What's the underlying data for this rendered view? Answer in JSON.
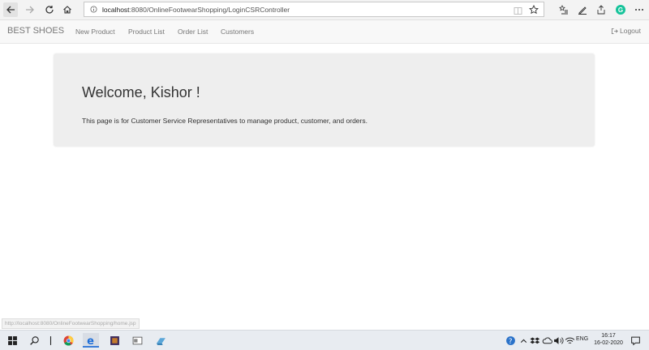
{
  "browser": {
    "url_host": "localhost",
    "url_path": ":8080/OnlineFootwearShopping/LoginCSRController"
  },
  "navbar": {
    "brand": "BEST SHOES",
    "links": [
      "New Product",
      "Product List",
      "Order List",
      "Customers"
    ],
    "logout_label": "Logout"
  },
  "jumbotron": {
    "heading": "Welcome, Kishor !",
    "text": "This page is for Customer Service Representatives to manage product, customer, and orders."
  },
  "status_bar_url": "http://localhost:8080/OnlineFootwearShopping/home.jsp",
  "taskbar": {
    "language": "ENG",
    "time": "16:17",
    "date": "16-02-2020"
  },
  "colors": {
    "navbar_bg": "#f8f8f8",
    "jumbotron_bg": "#eeeeee",
    "link_color": "#777777"
  }
}
